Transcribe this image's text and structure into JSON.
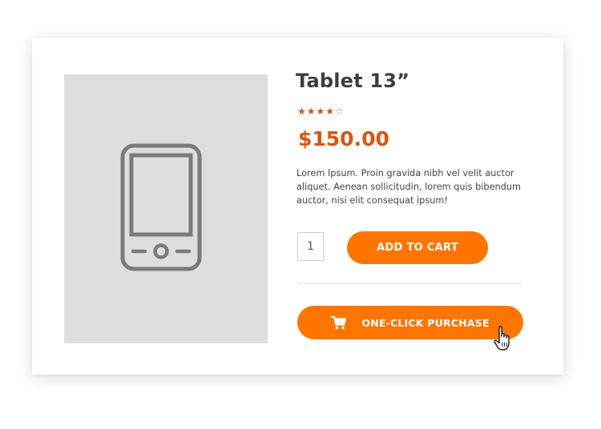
{
  "product": {
    "title": "Tablet 13”",
    "rating": 4,
    "rating_max": 5,
    "stars_full": "★★★★",
    "stars_empty": "☆",
    "price": "$150.00",
    "description": "Lorem Ipsum. Proin gravida nibh vel velit auctor aliquet. Aenean sollicitudin, lorem quis bibendum auctor, nisi elit consequat ipsum!",
    "image_icon": "smartphone-icon"
  },
  "purchase": {
    "quantity": "1",
    "add_to_cart_label": "ADD TO CART",
    "one_click_label": "ONE-CLICK PURCHASE",
    "one_click_icon": "cart-icon"
  },
  "colors": {
    "accent": "#ff7500",
    "price": "#d9560c",
    "image_background": "#dedede"
  },
  "cursor": "hand-pointer-icon"
}
